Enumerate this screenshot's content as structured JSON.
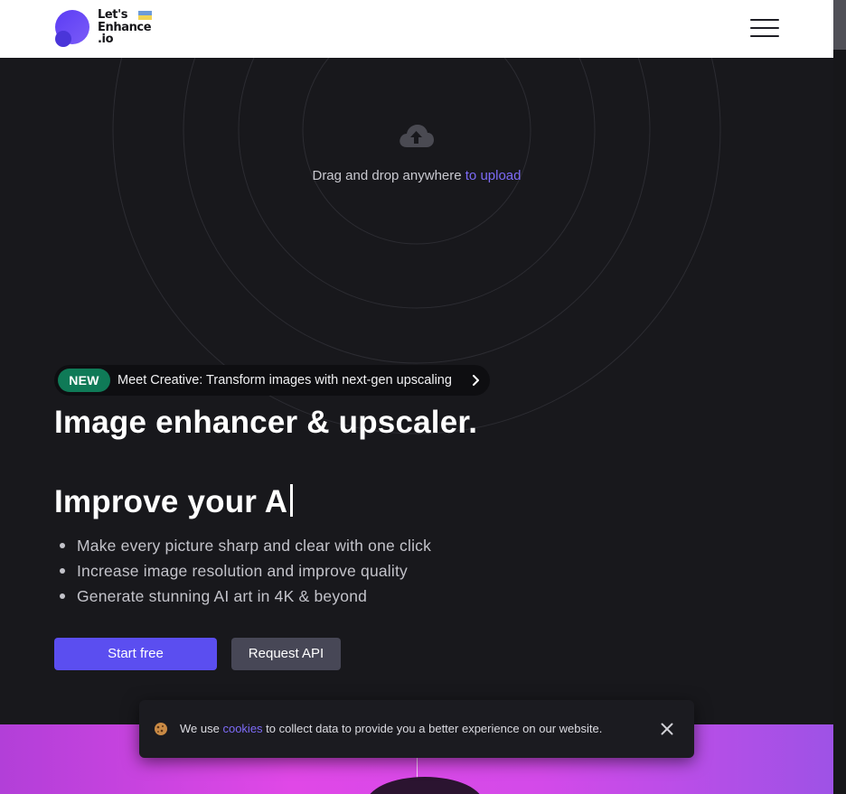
{
  "header": {
    "logo": {
      "lines": [
        "Let's",
        "Enhance",
        ".io"
      ],
      "colors": {
        "mark_primary": "#6a4ff5",
        "mark_secondary": "#4f46e5",
        "flag_blue": "#6d9bd9",
        "flag_yellow": "#f1d455"
      }
    },
    "menu_icon": "hamburger-icon"
  },
  "upload": {
    "icon": "cloud-upload-icon",
    "text": "Drag and drop anywhere",
    "link": "to upload"
  },
  "announcement": {
    "badge": "NEW",
    "text": "Meet Creative: Transform images with next-gen upscaling",
    "icon": "chevron-right-icon"
  },
  "hero": {
    "title": "Image enhancer & upscaler.",
    "typing_text": "Improve your A"
  },
  "features": [
    "Make every picture sharp and clear with one click",
    "Increase image resolution and improve quality",
    "Generate stunning AI art in 4K & beyond"
  ],
  "buttons": {
    "primary": "Start free",
    "secondary": "Request API"
  },
  "cookie": {
    "icon": "cookie-icon",
    "text_before": "We use",
    "link": "cookies",
    "text_after": "to collect data to provide you a better experience on our website.",
    "close_icon": "close-icon"
  },
  "colors": {
    "background": "#18181c",
    "accent": "#5b4ef0",
    "link": "#7d6bf7",
    "badge": "#0f7a57",
    "secondary_button": "#474756"
  }
}
